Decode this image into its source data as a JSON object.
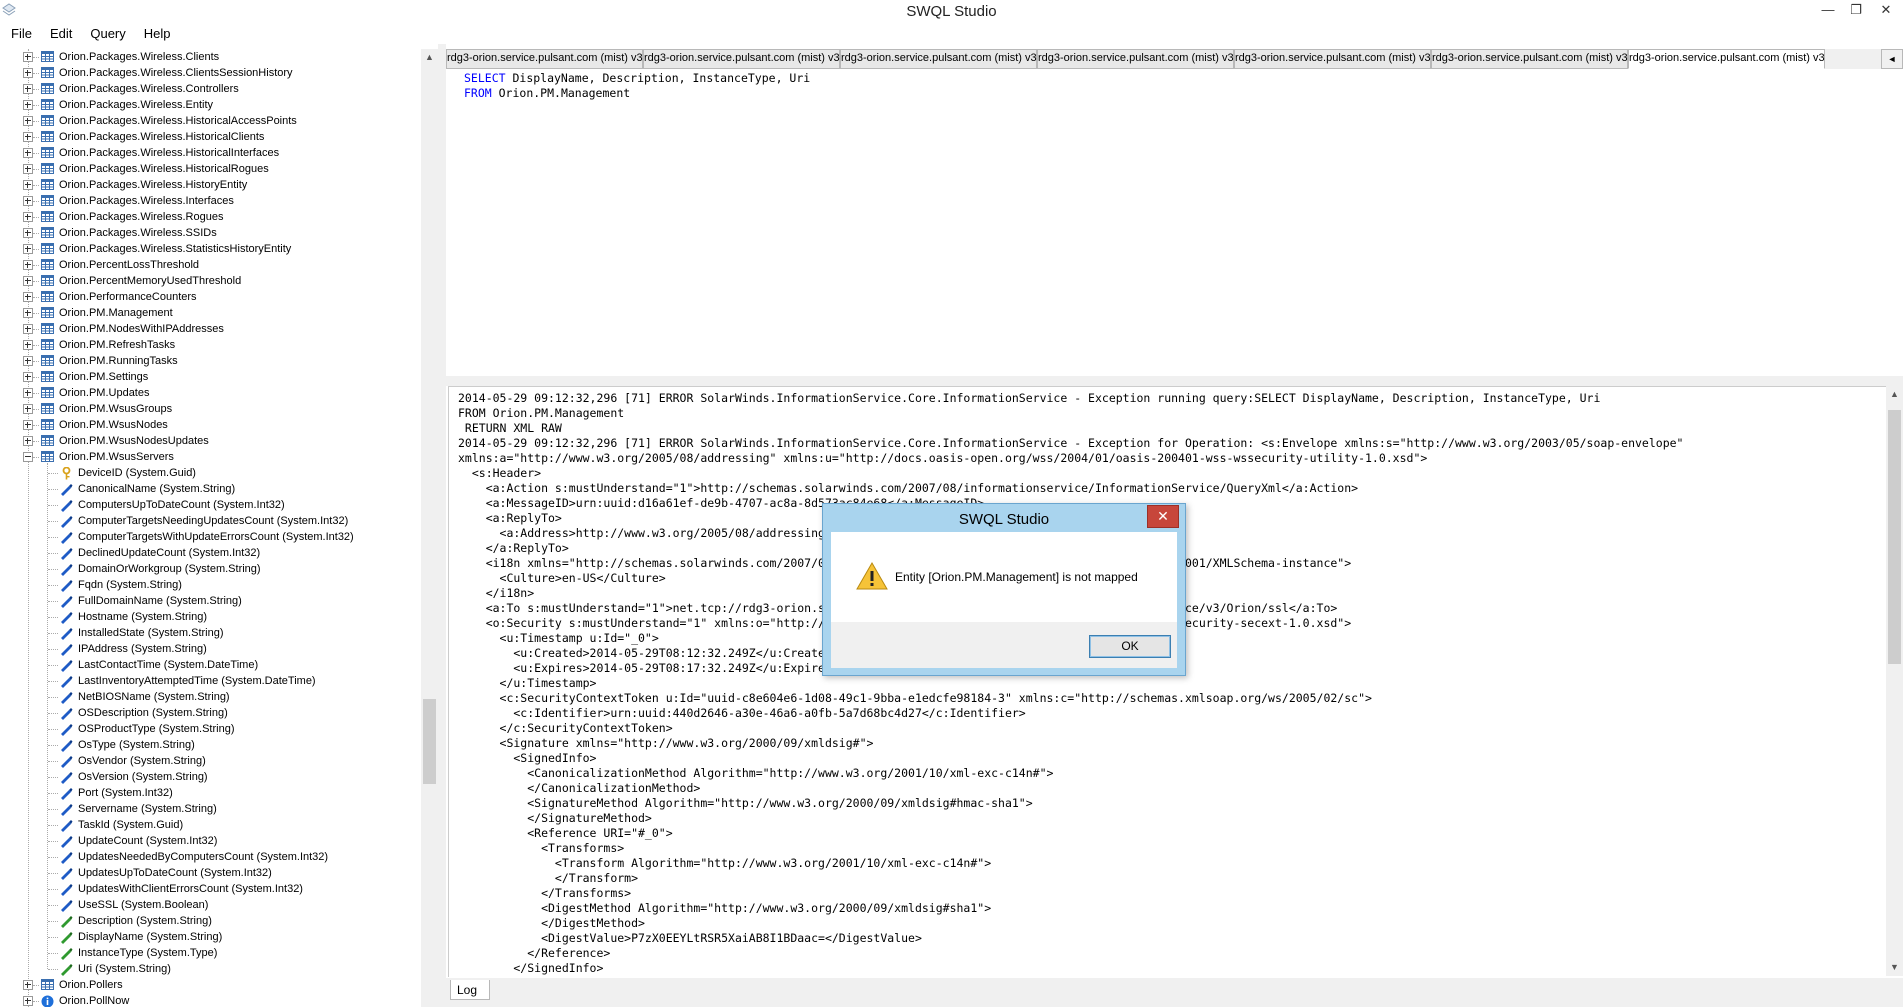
{
  "window": {
    "title": "SWQL Studio",
    "minimize_glyph": "—",
    "restore_glyph": "❐",
    "close_glyph": "✕"
  },
  "menu": [
    "File",
    "Edit",
    "Query",
    "Help"
  ],
  "tree": {
    "items": [
      {
        "label": "Orion.Packages.Wireless.Clients",
        "kind": "table",
        "depth": 0,
        "expander": "plus"
      },
      {
        "label": "Orion.Packages.Wireless.ClientsSessionHistory",
        "kind": "table",
        "depth": 0,
        "expander": "plus"
      },
      {
        "label": "Orion.Packages.Wireless.Controllers",
        "kind": "table",
        "depth": 0,
        "expander": "plus"
      },
      {
        "label": "Orion.Packages.Wireless.Entity",
        "kind": "table",
        "depth": 0,
        "expander": "plus"
      },
      {
        "label": "Orion.Packages.Wireless.HistoricalAccessPoints",
        "kind": "table",
        "depth": 0,
        "expander": "plus"
      },
      {
        "label": "Orion.Packages.Wireless.HistoricalClients",
        "kind": "table",
        "depth": 0,
        "expander": "plus"
      },
      {
        "label": "Orion.Packages.Wireless.HistoricalInterfaces",
        "kind": "table",
        "depth": 0,
        "expander": "plus"
      },
      {
        "label": "Orion.Packages.Wireless.HistoricalRogues",
        "kind": "table",
        "depth": 0,
        "expander": "plus"
      },
      {
        "label": "Orion.Packages.Wireless.HistoryEntity",
        "kind": "table",
        "depth": 0,
        "expander": "plus"
      },
      {
        "label": "Orion.Packages.Wireless.Interfaces",
        "kind": "table",
        "depth": 0,
        "expander": "plus"
      },
      {
        "label": "Orion.Packages.Wireless.Rogues",
        "kind": "table",
        "depth": 0,
        "expander": "plus"
      },
      {
        "label": "Orion.Packages.Wireless.SSIDs",
        "kind": "table",
        "depth": 0,
        "expander": "plus"
      },
      {
        "label": "Orion.Packages.Wireless.StatisticsHistoryEntity",
        "kind": "table",
        "depth": 0,
        "expander": "plus"
      },
      {
        "label": "Orion.PercentLossThreshold",
        "kind": "table",
        "depth": 0,
        "expander": "plus"
      },
      {
        "label": "Orion.PercentMemoryUsedThreshold",
        "kind": "table",
        "depth": 0,
        "expander": "plus"
      },
      {
        "label": "Orion.PerformanceCounters",
        "kind": "table",
        "depth": 0,
        "expander": "plus"
      },
      {
        "label": "Orion.PM.Management",
        "kind": "table",
        "depth": 0,
        "expander": "plus"
      },
      {
        "label": "Orion.PM.NodesWithIPAddresses",
        "kind": "table",
        "depth": 0,
        "expander": "plus"
      },
      {
        "label": "Orion.PM.RefreshTasks",
        "kind": "table",
        "depth": 0,
        "expander": "plus"
      },
      {
        "label": "Orion.PM.RunningTasks",
        "kind": "table",
        "depth": 0,
        "expander": "plus"
      },
      {
        "label": "Orion.PM.Settings",
        "kind": "table",
        "depth": 0,
        "expander": "plus"
      },
      {
        "label": "Orion.PM.Updates",
        "kind": "table",
        "depth": 0,
        "expander": "plus"
      },
      {
        "label": "Orion.PM.WsusGroups",
        "kind": "table",
        "depth": 0,
        "expander": "plus"
      },
      {
        "label": "Orion.PM.WsusNodes",
        "kind": "table",
        "depth": 0,
        "expander": "plus"
      },
      {
        "label": "Orion.PM.WsusNodesUpdates",
        "kind": "table",
        "depth": 0,
        "expander": "plus"
      },
      {
        "label": "Orion.PM.WsusServers",
        "kind": "table",
        "depth": 0,
        "expander": "minus"
      },
      {
        "label": "DeviceID (System.Guid)",
        "kind": "key",
        "depth": 1
      },
      {
        "label": "CanonicalName (System.String)",
        "kind": "prop",
        "depth": 1
      },
      {
        "label": "ComputersUpToDateCount (System.Int32)",
        "kind": "prop",
        "depth": 1
      },
      {
        "label": "ComputerTargetsNeedingUpdatesCount (System.Int32)",
        "kind": "prop",
        "depth": 1
      },
      {
        "label": "ComputerTargetsWithUpdateErrorsCount (System.Int32)",
        "kind": "prop",
        "depth": 1
      },
      {
        "label": "DeclinedUpdateCount (System.Int32)",
        "kind": "prop",
        "depth": 1
      },
      {
        "label": "DomainOrWorkgroup (System.String)",
        "kind": "prop",
        "depth": 1
      },
      {
        "label": "Fqdn (System.String)",
        "kind": "prop",
        "depth": 1
      },
      {
        "label": "FullDomainName (System.String)",
        "kind": "prop",
        "depth": 1
      },
      {
        "label": "Hostname (System.String)",
        "kind": "prop",
        "depth": 1
      },
      {
        "label": "InstalledState (System.String)",
        "kind": "prop",
        "depth": 1
      },
      {
        "label": "IPAddress (System.String)",
        "kind": "prop",
        "depth": 1
      },
      {
        "label": "LastContactTime (System.DateTime)",
        "kind": "prop",
        "depth": 1
      },
      {
        "label": "LastInventoryAttemptedTime (System.DateTime)",
        "kind": "prop",
        "depth": 1
      },
      {
        "label": "NetBIOSName (System.String)",
        "kind": "prop",
        "depth": 1
      },
      {
        "label": "OSDescription (System.String)",
        "kind": "prop",
        "depth": 1
      },
      {
        "label": "OSProductType (System.String)",
        "kind": "prop",
        "depth": 1
      },
      {
        "label": "OsType (System.String)",
        "kind": "prop",
        "depth": 1
      },
      {
        "label": "OsVendor (System.String)",
        "kind": "prop",
        "depth": 1
      },
      {
        "label": "OsVersion (System.String)",
        "kind": "prop",
        "depth": 1
      },
      {
        "label": "Port (System.Int32)",
        "kind": "prop",
        "depth": 1
      },
      {
        "label": "Servername (System.String)",
        "kind": "prop",
        "depth": 1
      },
      {
        "label": "TaskId (System.Guid)",
        "kind": "prop",
        "depth": 1
      },
      {
        "label": "UpdateCount (System.Int32)",
        "kind": "prop",
        "depth": 1
      },
      {
        "label": "UpdatesNeededByComputersCount (System.Int32)",
        "kind": "prop",
        "depth": 1
      },
      {
        "label": "UpdatesUpToDateCount (System.Int32)",
        "kind": "prop",
        "depth": 1
      },
      {
        "label": "UpdatesWithClientErrorsCount (System.Int32)",
        "kind": "prop",
        "depth": 1
      },
      {
        "label": "UseSSL (System.Boolean)",
        "kind": "prop",
        "depth": 1
      },
      {
        "label": "Description (System.String)",
        "kind": "inherited",
        "depth": 1
      },
      {
        "label": "DisplayName (System.String)",
        "kind": "inherited",
        "depth": 1
      },
      {
        "label": "InstanceType (System.Type)",
        "kind": "inherited",
        "depth": 1
      },
      {
        "label": "Uri (System.String)",
        "kind": "inherited",
        "depth": 1
      },
      {
        "label": "Orion.Pollers",
        "kind": "table",
        "depth": 0,
        "expander": "plus"
      },
      {
        "label": "Orion.PollNow",
        "kind": "info",
        "depth": 0,
        "expander": "plus"
      }
    ]
  },
  "tabs": [
    {
      "label": "rdg3-orion.service.pulsant.com (mist) v3",
      "active": false
    },
    {
      "label": "rdg3-orion.service.pulsant.com (mist) v3",
      "active": false
    },
    {
      "label": "rdg3-orion.service.pulsant.com (mist) v3",
      "active": false
    },
    {
      "label": "rdg3-orion.service.pulsant.com (mist) v3",
      "active": false
    },
    {
      "label": "rdg3-orion.service.pulsant.com (mist) v3",
      "active": false
    },
    {
      "label": "rdg3-orion.service.pulsant.com (mist) v3",
      "active": false
    },
    {
      "label": "rdg3-orion.service.pulsant.com (mist) v3",
      "active": true
    }
  ],
  "query": [
    {
      "kw": "SELECT",
      "rest": " DisplayName, Description, InstanceType, Uri"
    },
    {
      "kw": "FROM",
      "rest": " Orion.PM.Management"
    }
  ],
  "log_lines": [
    "2014-05-29 09:12:32,296 [71] ERROR SolarWinds.InformationService.Core.InformationService - Exception running query:SELECT DisplayName, Description, InstanceType, Uri",
    "FROM Orion.PM.Management",
    " RETURN XML RAW",
    "2014-05-29 09:12:32,296 [71] ERROR SolarWinds.InformationService.Core.InformationService - Exception for Operation: <s:Envelope xmlns:s=\"http://www.w3.org/2003/05/soap-envelope\"",
    "xmlns:a=\"http://www.w3.org/2005/08/addressing\" xmlns:u=\"http://docs.oasis-open.org/wss/2004/01/oasis-200401-wss-wssecurity-utility-1.0.xsd\">",
    "  <s:Header>",
    "    <a:Action s:mustUnderstand=\"1\">http://schemas.solarwinds.com/2007/08/informationservice/InformationService/QueryXml</a:Action>",
    "    <a:MessageID>urn:uuid:d16a61ef-de9b-4707-ac8a-8d573ac84e68</a:MessageID>",
    "    <a:ReplyTo>",
    "      <a:Address>http://www.w3.org/2005/08/addressing/anonymous</a:Address>",
    "    </a:ReplyTo>",
    "    <i18n xmlns=\"http://schemas.solarwinds.com/2007/08/informationservice\" xmlns:xsi=\"http://www.w3.org/2001/XMLSchema-instance\">",
    "      <Culture>en-US</Culture>",
    "    </i18n>",
    "    <a:To s:mustUnderstand=\"1\">net.tcp://rdg3-orion.service.pulsant.com:17777/SolarWinds/InformationService/v3/Orion/ssl</a:To>",
    "    <o:Security s:mustUnderstand=\"1\" xmlns:o=\"http://docs.oasis-open.org/wss/2004/01/oasis-200401-wss-wssecurity-secext-1.0.xsd\">",
    "      <u:Timestamp u:Id=\"_0\">",
    "        <u:Created>2014-05-29T08:12:32.249Z</u:Created>",
    "        <u:Expires>2014-05-29T08:17:32.249Z</u:Expires>",
    "      </u:Timestamp>",
    "      <c:SecurityContextToken u:Id=\"uuid-c8e604e6-1d08-49c1-9bba-e1edcfe98184-3\" xmlns:c=\"http://schemas.xmlsoap.org/ws/2005/02/sc\">",
    "        <c:Identifier>urn:uuid:440d2646-a30e-46a6-a0fb-5a7d68bc4d27</c:Identifier>",
    "      </c:SecurityContextToken>",
    "      <Signature xmlns=\"http://www.w3.org/2000/09/xmldsig#\">",
    "        <SignedInfo>",
    "          <CanonicalizationMethod Algorithm=\"http://www.w3.org/2001/10/xml-exc-c14n#\">",
    "          </CanonicalizationMethod>",
    "          <SignatureMethod Algorithm=\"http://www.w3.org/2000/09/xmldsig#hmac-sha1\">",
    "          </SignatureMethod>",
    "          <Reference URI=\"#_0\">",
    "            <Transforms>",
    "              <Transform Algorithm=\"http://www.w3.org/2001/10/xml-exc-c14n#\">",
    "              </Transform>",
    "            </Transforms>",
    "            <DigestMethod Algorithm=\"http://www.w3.org/2000/09/xmldsig#sha1\">",
    "            </DigestMethod>",
    "            <DigestValue>P7zX0EEYLtRSR5XaiAB8I1BDaac=</DigestValue>",
    "          </Reference>",
    "        </SignedInfo>"
  ],
  "bottom_tab": "Log",
  "dialog": {
    "title": "SWQL Studio",
    "message": "Entity [Orion.PM.Management] is not mapped",
    "ok_label": "OK",
    "close_glyph": "✕",
    "icon": "warning-icon"
  },
  "scroll_glyphs": {
    "up": "▲",
    "down": "▼",
    "left": "◄"
  },
  "colors": {
    "keyword": "#0000ff",
    "dialog_frame": "#a9d4ee",
    "close_button": "#c7463b",
    "table_icon": "#3a6fb0",
    "prop_icon": "#1e5bc6",
    "inherited_icon": "#2f9a2f",
    "key_icon": "#d9a21b"
  }
}
